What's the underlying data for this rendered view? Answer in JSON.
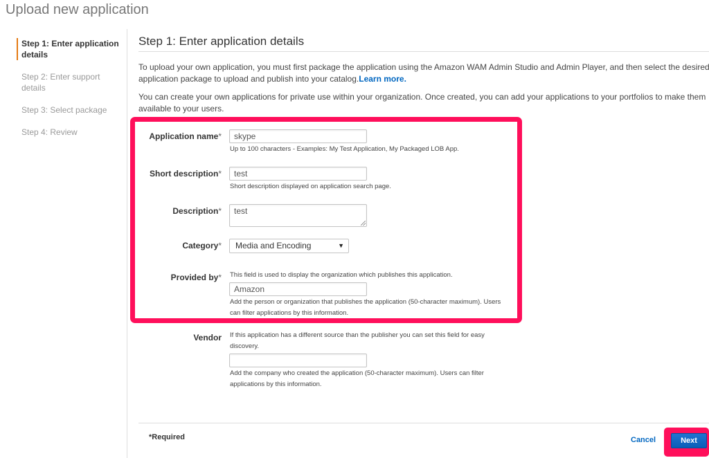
{
  "page": {
    "title": "Upload new application"
  },
  "sidebar": {
    "steps": [
      {
        "label": "Step 1: Enter application details"
      },
      {
        "label": "Step 2: Enter support details"
      },
      {
        "label": "Step 3: Select package"
      },
      {
        "label": "Step 4: Review"
      }
    ]
  },
  "main": {
    "heading": "Step 1: Enter application details",
    "intro1": "To upload your own application, you must first package the application using the Amazon WAM Admin Studio and Admin Player, and then select the desired application package to upload and publish into your catalog.",
    "learn_more": "Learn more.",
    "intro2": "You can create your own applications for private use within your organization. Once created, you can add your applications to your portfolios to make them available to your users."
  },
  "form": {
    "required_mark": "*",
    "app_name": {
      "label": "Application name",
      "value": "skype",
      "help": "Up to 100 characters - Examples: My Test Application, My Packaged LOB App."
    },
    "short_desc": {
      "label": "Short description",
      "value": "test",
      "help": "Short description displayed on application search page."
    },
    "description": {
      "label": "Description",
      "value": "test"
    },
    "category": {
      "label": "Category",
      "value": "Media and Encoding"
    },
    "provided_by": {
      "label": "Provided by",
      "help_top": "This field is used to display the organization which publishes this application.",
      "value": "Amazon",
      "help_bottom": "Add the person or organization that publishes the application (50-character maximum). Users can filter applications by this information."
    },
    "vendor": {
      "label": "Vendor",
      "help_top": "If this application has a different source than the publisher you can set this field for easy discovery.",
      "value": "",
      "help_bottom": "Add the company who created the application (50-character maximum). Users can filter applications by this information."
    }
  },
  "footer": {
    "required_note": "*Required",
    "cancel": "Cancel",
    "next": "Next"
  },
  "colors": {
    "highlight": "#ff0f5b",
    "active_step_accent": "#e47911",
    "link": "#0066c0",
    "primary_button": "#0b5eb8"
  }
}
